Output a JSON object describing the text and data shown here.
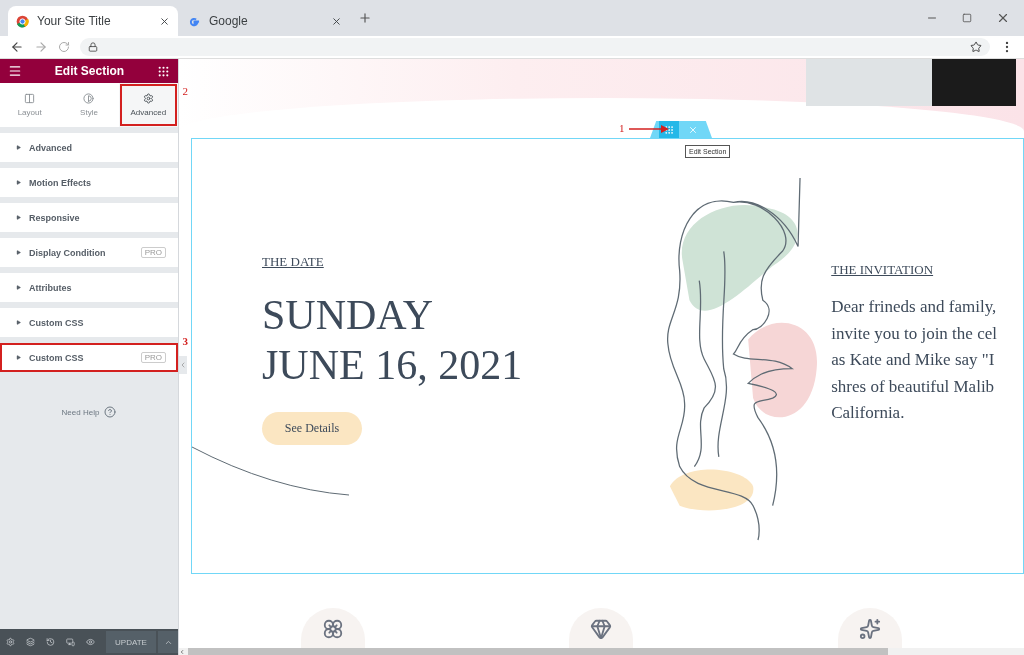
{
  "browser": {
    "tabs": [
      {
        "title": "Your Site Title",
        "kind": "chrome",
        "selected": true
      },
      {
        "title": "Google",
        "kind": "google",
        "selected": false
      }
    ]
  },
  "editor": {
    "title": "Edit Section",
    "tabs": [
      {
        "label": "Layout",
        "selected": false
      },
      {
        "label": "Style",
        "selected": false
      },
      {
        "label": "Advanced",
        "selected": true,
        "annotation": "2"
      }
    ],
    "sections": [
      {
        "label": "Advanced"
      },
      {
        "label": "Motion Effects"
      },
      {
        "label": "Responsive"
      },
      {
        "label": "Display Condition",
        "badge": "PRO"
      },
      {
        "label": "Attributes"
      },
      {
        "label": "Custom CSS"
      },
      {
        "label": "Custom CSS",
        "badge": "PRO",
        "annotation": "3"
      }
    ],
    "help": "Need Help",
    "update_button": "UPDATE"
  },
  "canvas": {
    "handle": {
      "annotation": "1",
      "tooltip": "Edit Section"
    },
    "date": {
      "eyebrow": "THE DATE",
      "heading": [
        "SUNDAY",
        "JUNE 16, 2021"
      ],
      "button": "See Details"
    },
    "invitation": {
      "eyebrow": "THE INVITATION",
      "lines": [
        "Dear frineds and family,",
        "invite you to join the cel",
        "as Kate and Mike say \"I",
        "shres of beautiful Malib",
        "California."
      ]
    }
  }
}
